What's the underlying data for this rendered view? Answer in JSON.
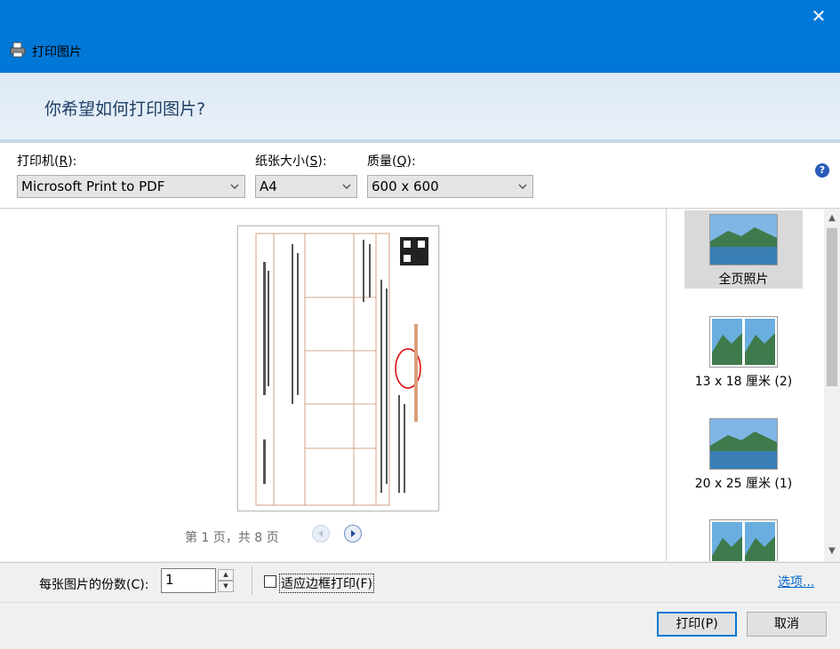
{
  "window": {
    "title": "打印图片",
    "close_glyph": "✕"
  },
  "header": {
    "question": "你希望如何打印图片?"
  },
  "printer": {
    "label_text": "打印机(",
    "label_key": "R",
    "label_end": "):",
    "value": "Microsoft Print to PDF"
  },
  "paper": {
    "label_text": "纸张大小(",
    "label_key": "S",
    "label_end": "):",
    "value": "A4"
  },
  "quality": {
    "label_text": "质量(",
    "label_key": "Q",
    "label_end": "):",
    "value": "600 x 600"
  },
  "help_glyph": "?",
  "preview": {
    "page_info": "第 1 页，共 8 页"
  },
  "layouts": [
    {
      "label": "全页照片",
      "selected": true,
      "icon": "single-photo"
    },
    {
      "label": "13 x 18 厘米 (2)",
      "selected": false,
      "icon": "two-photos"
    },
    {
      "label": "20 x 25 厘米 (1)",
      "selected": false,
      "icon": "single-photo"
    },
    {
      "label": "",
      "selected": false,
      "icon": "two-photos"
    }
  ],
  "copies": {
    "label": "每张图片的份数(C):",
    "value": "1"
  },
  "fit_frame": {
    "label": "适应边框打印(F)",
    "checked": false
  },
  "options_link": "选项...",
  "buttons": {
    "print": "打印(P)",
    "cancel": "取消"
  },
  "colors": {
    "titlebar": "#0078d7",
    "link": "#0066cc"
  }
}
